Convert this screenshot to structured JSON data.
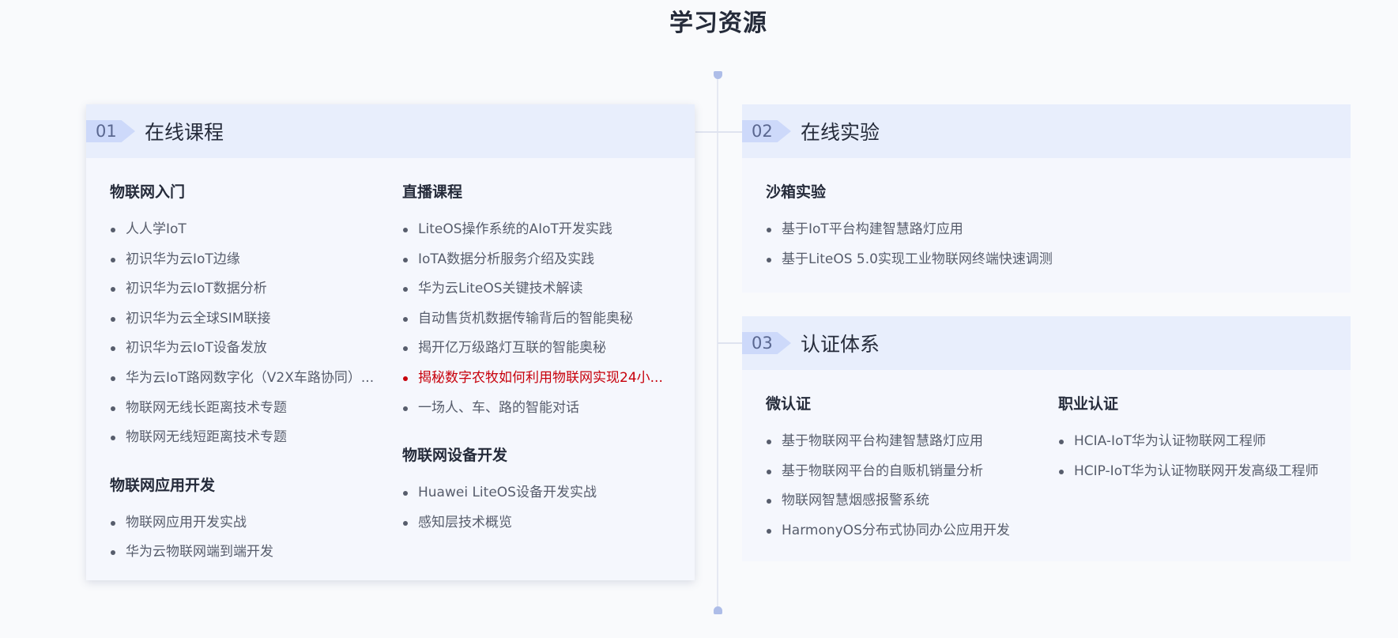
{
  "page": {
    "title": "学习资源"
  },
  "cards": [
    {
      "num": "01",
      "title": "在线课程",
      "columns": [
        [
          {
            "title": "物联网入门",
            "items": [
              "人人学IoT",
              "初识华为云IoT边缘",
              "初识华为云IoT数据分析",
              "初识华为云全球SIM联接",
              "初识华为云IoT设备发放",
              "华为云IoT路网数字化（V2X车路协同）...",
              "物联网无线长距离技术专题",
              "物联网无线短距离技术专题"
            ]
          },
          {
            "title": "物联网应用开发",
            "items": [
              "物联网应用开发实战",
              "华为云物联网端到端开发"
            ]
          }
        ],
        [
          {
            "title": "直播课程",
            "items": [
              "LiteOS操作系统的AIoT开发实践",
              "IoTA数据分析服务介绍及实践",
              "华为云LiteOS关键技术解读",
              "自动售货机数据传输背后的智能奥秘",
              "揭开亿万级路灯互联的智能奥秘",
              "揭秘数字农牧如何利用物联网实现24小...",
              "一场人、车、路的智能对话"
            ]
          },
          {
            "title": "物联网设备开发",
            "items": [
              "Huawei LiteOS设备开发实战",
              "感知层技术概览"
            ]
          }
        ]
      ]
    },
    {
      "num": "02",
      "title": "在线实验",
      "columns": [
        [
          {
            "title": "沙箱实验",
            "items": [
              "基于IoT平台构建智慧路灯应用",
              "基于LiteOS 5.0实现工业物联网终端快速调测"
            ]
          }
        ]
      ]
    },
    {
      "num": "03",
      "title": "认证体系",
      "columns": [
        [
          {
            "title": "微认证",
            "items": [
              "基于物联网平台构建智慧路灯应用",
              "基于物联网平台的自贩机销量分析",
              "物联网智慧烟感报警系统",
              "HarmonyOS分布式协同办公应用开发"
            ]
          }
        ],
        [
          {
            "title": "职业认证",
            "items": [
              "HCIA-IoT华为认证物联网工程师",
              "HCIP-IoT华为认证物联网开发高级工程师"
            ]
          }
        ]
      ]
    }
  ],
  "highlight": {
    "card": 0,
    "column": 1,
    "section": 0,
    "item": 5,
    "color": "#c7000b"
  }
}
